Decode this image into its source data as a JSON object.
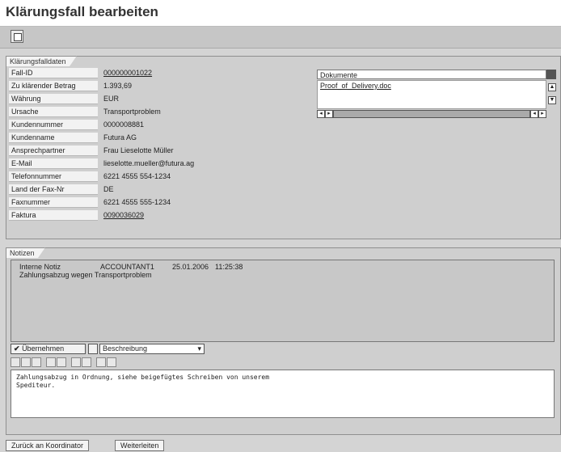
{
  "page": {
    "title": "Klärungsfall bearbeiten"
  },
  "toolbar": {
    "icon": "display-change-icon"
  },
  "case_data": {
    "group_title": "Klärungsfalldaten",
    "fields": [
      {
        "label": "Fall-ID",
        "value": "000000001022",
        "link": true
      },
      {
        "label": "Zu klärender Betrag",
        "value": "1.393,69",
        "link": false
      },
      {
        "label": "Währung",
        "value": "EUR",
        "link": false
      },
      {
        "label": "Ursache",
        "value": "Transportproblem",
        "link": false
      },
      {
        "label": "Kundennummer",
        "value": "0000008881",
        "link": false
      },
      {
        "label": "Kundenname",
        "value": "Futura AG",
        "link": false
      },
      {
        "label": "Ansprechpartner",
        "value": "Frau Lieselotte Müller",
        "link": false
      },
      {
        "label": "E-Mail",
        "value": "lieselotte.mueller@futura.ag",
        "link": false
      },
      {
        "label": "Telefonnummer",
        "value": "6221 4555 554-1234",
        "link": false
      },
      {
        "label": "Land der Fax-Nr",
        "value": "DE",
        "link": false
      },
      {
        "label": "Faxnummer",
        "value": "6221 4555 555-1234",
        "link": false
      },
      {
        "label": "Faktura",
        "value": "0090036029",
        "link": true
      }
    ]
  },
  "documents": {
    "header": "Dokumente",
    "items": [
      "Proof_of_Delivery.doc"
    ]
  },
  "notes": {
    "group_title": "Notizen",
    "entry": {
      "type": "Interne Notiz",
      "user": "ACCOUNTANT1",
      "date": "25.01.2006",
      "time": "11:25:38",
      "text": "Zahlungsabzug wegen Transportproblem"
    },
    "apply_label": "Übernehmen",
    "description_select": "Beschreibung",
    "input_text": "Zahlungsabzug in Ordnung, siehe beigefügtes Schreiben von unserem\nSpediteur."
  },
  "actions": {
    "back_label": "Zurück an Koordinator",
    "forward_label": "Weiterleiten"
  }
}
